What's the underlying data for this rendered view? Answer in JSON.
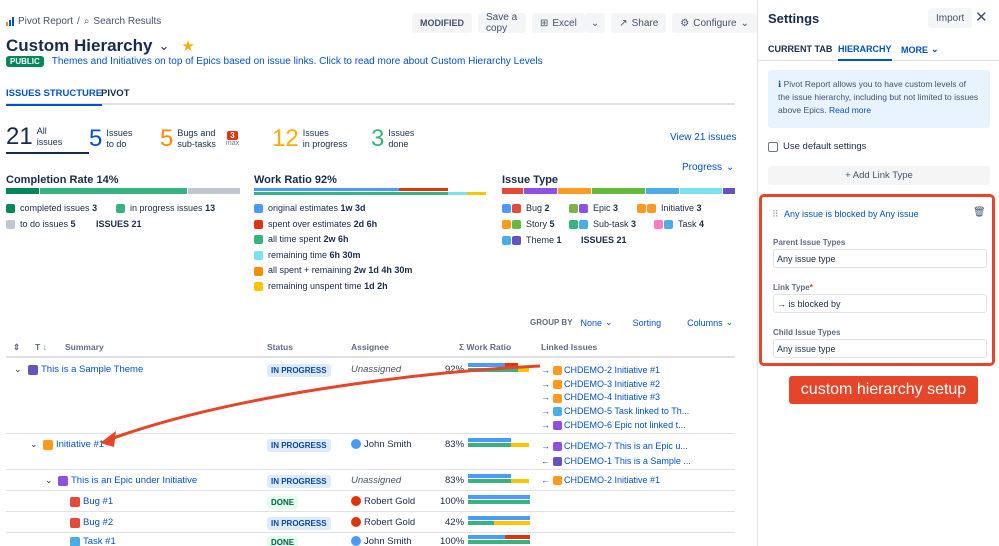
{
  "header": {
    "breadcrumb_root": "Pivot Report",
    "breadcrumb_sep": "/",
    "breadcrumb_current": "Search Results",
    "title": "Custom Hierarchy",
    "badge_public": "PUBLIC",
    "description": "Themes and Initiatives on top of Epics based on issue links. Click to read more about Custom Hierarchy Levels",
    "modified": "MODIFIED",
    "save_copy": "Save a copy",
    "excel": "Excel",
    "share": "Share",
    "configure": "Configure"
  },
  "tabs": [
    "ISSUES STRUCTURE",
    "PIVOT"
  ],
  "summary_stats": [
    {
      "count": "21",
      "label1": "All",
      "label2": "issues",
      "color": "#172b4d"
    },
    {
      "count": "5",
      "label1": "Issues",
      "label2": "to do",
      "color": "#0052cc"
    },
    {
      "count": "5",
      "label1": "Bugs and",
      "label2": "sub-tasks",
      "color": "#ff8b00",
      "badge": "3",
      "badge_sub": "max"
    },
    {
      "count": "12",
      "label1": "Issues",
      "label2": "in progress",
      "color": "#ffab00"
    },
    {
      "count": "3",
      "label1": "Issues",
      "label2": "done",
      "color": "#36b37e"
    }
  ],
  "view_all": "View 21 issues",
  "progress_dropdown": "Progress",
  "completion": {
    "title": "Completion Rate",
    "pct": "14%",
    "items": [
      {
        "label": "completed issues",
        "value": "3",
        "color": "#00875a"
      },
      {
        "label": "in progress issues",
        "value": "13",
        "color": "#36b37e"
      },
      {
        "label": "to do issues",
        "value": "5",
        "color": "#c1c7d0"
      }
    ],
    "total_label": "ISSUES",
    "total_value": "21"
  },
  "work_ratio": {
    "title": "Work Ratio",
    "pct": "92%",
    "items": [
      {
        "label": "original estimates",
        "value": "1w 3d",
        "color": "#4c9aff"
      },
      {
        "label": "spent over estimates",
        "value": "2d 6h",
        "color": "#de350b"
      },
      {
        "label": "all time spent",
        "value": "2w 6h",
        "color": "#36b37e"
      },
      {
        "label": "remaining time",
        "value": "6h 30m",
        "color": "#79e2f2"
      },
      {
        "label": "all spent + remaining",
        "value": "2w 1d 4h 30m",
        "color": "#ff8b00"
      },
      {
        "label": "remaining unspent time",
        "value": "1d 2h",
        "color": "#ffc400"
      }
    ]
  },
  "issue_type": {
    "title": "Issue Type",
    "items": [
      {
        "label": "Bug",
        "value": "2",
        "color": "#e5493a",
        "icon": "bug-icon"
      },
      {
        "label": "Epic",
        "value": "3",
        "color": "#904ee2",
        "icon": "epic-icon"
      },
      {
        "label": "Initiative",
        "value": "3",
        "color": "#ff991f",
        "icon": "initiative-icon"
      },
      {
        "label": "Story",
        "value": "5",
        "color": "#63ba3c",
        "icon": "story-icon"
      },
      {
        "label": "Sub-task",
        "value": "3",
        "color": "#4bade8",
        "icon": "subtask-icon"
      },
      {
        "label": "Task",
        "value": "4",
        "color": "#4bade8",
        "icon": "task-icon"
      },
      {
        "label": "Theme",
        "value": "1",
        "color": "#6554c0",
        "icon": "theme-icon"
      }
    ],
    "total_label": "ISSUES",
    "total_value": "21"
  },
  "table_controls": {
    "group_by_label": "GROUP BY",
    "group_by_value": "None",
    "sorting": "Sorting",
    "columns": "Columns"
  },
  "table_headers": {
    "t": "T",
    "summary": "Summary",
    "status": "Status",
    "assignee": "Assignee",
    "work_ratio": "Σ Work Ratio",
    "linked": "Linked Issues"
  },
  "rows": [
    {
      "summary": "This is a Sample Theme",
      "status": "IN PROGRESS",
      "assignee": "Unassigned",
      "ratio": "92%",
      "type": "theme"
    },
    {
      "summary": "Initiative #1",
      "status": "IN PROGRESS",
      "assignee": "John Smith",
      "ratio": "83%",
      "type": "initiative"
    },
    {
      "summary": "This is an Epic under Initiative",
      "status": "IN PROGRESS",
      "assignee": "Unassigned",
      "ratio": "83%",
      "type": "epic"
    },
    {
      "summary": "Bug #1",
      "status": "DONE",
      "assignee": "Robert Gold",
      "ratio": "100%",
      "type": "bug"
    },
    {
      "summary": "Bug #2",
      "status": "IN PROGRESS",
      "assignee": "Robert Gold",
      "ratio": "42%",
      "type": "bug"
    },
    {
      "summary": "Task #1",
      "status": "DONE",
      "assignee": "John Smith",
      "ratio": "100%",
      "type": "task"
    }
  ],
  "linked": [
    "CHDEMO-2 Initiative #1",
    "CHDEMO-3 Initiative #2",
    "CHDEMO-4 Initiative #3",
    "CHDEMO-5 Task linked to Th...",
    "CHDEMO-6 Epic not linked t...",
    "CHDEMO-7 This is an Epic u...",
    "CHDEMO-1 This is a Sample ...",
    "CHDEMO-2 Initiative #1"
  ],
  "settings": {
    "title": "Settings",
    "import": "Import",
    "tabs": [
      "CURRENT TAB",
      "HIERARCHY",
      "MORE"
    ],
    "info": "Pivot Report allows you to have custom levels of the issue hierarchy, including but not limited to issues above Epics.",
    "read_more": "Read more",
    "default_settings": "Use default settings",
    "add_link": "+ Add Link Type",
    "rule_title": "Any issue is blocked by Any issue",
    "parent_label": "Parent Issue Types",
    "parent_value": "Any issue type",
    "link_label": "Link Type",
    "link_required": "*",
    "link_value": "→ is blocked by",
    "child_label": "Child Issue Types",
    "child_value": "Any issue type",
    "callout": "custom hierarchy setup"
  },
  "colors": {
    "accent": "#0052cc",
    "annotation": "#e5462a"
  }
}
